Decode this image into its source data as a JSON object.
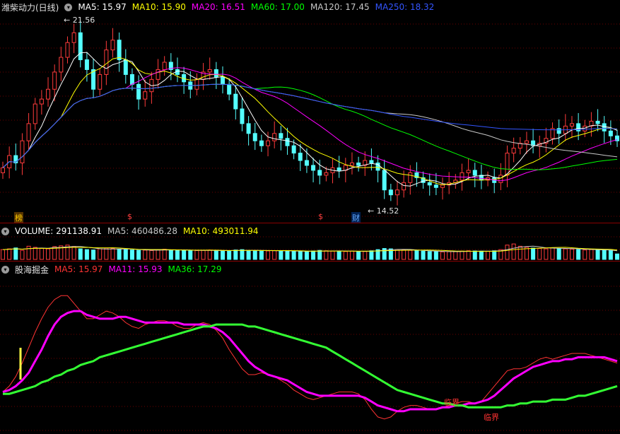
{
  "price_pane": {
    "stock_title": "潍柴动力(日线)",
    "ma_items": [
      {
        "label": "MA5: 15.97",
        "color": "#ffffff"
      },
      {
        "label": "MA10: 15.90",
        "color": "#ffff00"
      },
      {
        "label": "MA20: 16.51",
        "color": "#ff00ff"
      },
      {
        "label": "MA60: 17.00",
        "color": "#00ff00"
      },
      {
        "label": "MA120: 17.45",
        "color": "#c8c8c8"
      },
      {
        "label": "MA250: 18.32",
        "color": "#3355ff"
      }
    ],
    "high_label": "21.56",
    "low_label": "14.52",
    "event_tags": {
      "bang": "榜",
      "s1": "$",
      "s2": "$",
      "cai": "财"
    }
  },
  "volume_pane": {
    "items": [
      {
        "label": "VOLUME: 291138.91",
        "color": "#ffffff"
      },
      {
        "label": "MA5: 460486.28",
        "color": "#c8c8c8"
      },
      {
        "label": "MA10: 493011.94",
        "color": "#ffff00"
      }
    ]
  },
  "indicator_pane": {
    "title": "股海掘金",
    "items": [
      {
        "label": "MA5: 15.97",
        "color": "#ff3333"
      },
      {
        "label": "MA11: 15.93",
        "color": "#ff00ff"
      },
      {
        "label": "MA36: 17.29",
        "color": "#00ff00"
      }
    ],
    "critical_label_1": "临界",
    "critical_label_2": "临界"
  },
  "chart_data": {
    "type": "candlestick",
    "price_range": [
      14.0,
      22.0
    ],
    "closes": [
      15.8,
      16.3,
      16.0,
      16.9,
      17.6,
      18.4,
      18.6,
      19.0,
      19.7,
      20.3,
      20.9,
      21.3,
      20.2,
      19.8,
      19.0,
      19.6,
      20.6,
      21.0,
      20.2,
      19.6,
      19.2,
      18.6,
      18.9,
      19.4,
      19.8,
      20.1,
      19.8,
      19.6,
      19.3,
      19.0,
      19.4,
      19.7,
      19.8,
      19.5,
      19.2,
      18.8,
      18.2,
      17.6,
      17.2,
      16.9,
      16.7,
      16.9,
      17.2,
      17.0,
      16.7,
      16.4,
      16.1,
      15.9,
      15.7,
      15.5,
      15.6,
      15.8,
      15.7,
      15.9,
      16.0,
      15.9,
      16.1,
      16.0,
      15.7,
      14.9,
      14.7,
      14.9,
      15.2,
      15.6,
      15.4,
      15.2,
      15.1,
      15.0,
      15.1,
      15.2,
      15.3,
      15.6,
      15.7,
      15.5,
      15.3,
      15.4,
      15.2,
      15.5,
      16.4,
      16.6,
      16.8,
      16.9,
      16.7,
      16.8,
      17.0,
      17.4,
      17.2,
      17.5,
      17.6,
      17.3,
      17.5,
      17.7,
      17.6,
      17.3,
      17.1,
      16.9
    ],
    "volume_range": [
      0,
      1200000
    ],
    "volumes": [
      520000,
      560000,
      610000,
      480000,
      700000,
      640000,
      590000,
      560000,
      680000,
      720000,
      760000,
      690000,
      560000,
      520000,
      500000,
      560000,
      600000,
      580000,
      540000,
      520000,
      500000,
      480000,
      490000,
      470000,
      520000,
      540000,
      500000,
      490000,
      480000,
      460000,
      470000,
      480000,
      500000,
      460000,
      440000,
      460000,
      500000,
      520000,
      480000,
      460000,
      440000,
      450000,
      470000,
      460000,
      440000,
      430000,
      420000,
      410000,
      450000,
      480000,
      460000,
      440000,
      430000,
      420000,
      440000,
      430000,
      420000,
      460000,
      520000,
      580000,
      560000,
      520000,
      500000,
      480000,
      460000,
      440000,
      420000,
      410000,
      400000,
      410000,
      420000,
      440000,
      460000,
      450000,
      440000,
      430000,
      460000,
      520000,
      760000,
      820000,
      700000,
      640000,
      600000,
      580000,
      560000,
      620000,
      580000,
      560000,
      540000,
      520000,
      500000,
      520000,
      510000,
      490000,
      470000,
      291139
    ],
    "indicator_range": [
      14.0,
      22.0
    ],
    "ind_ma5": [
      16.0,
      16.3,
      16.8,
      17.5,
      18.3,
      19.1,
      19.8,
      20.4,
      20.8,
      21.0,
      21.0,
      20.6,
      20.2,
      19.8,
      19.8,
      20.0,
      20.2,
      20.1,
      19.9,
      19.6,
      19.4,
      19.3,
      19.5,
      19.6,
      19.7,
      19.7,
      19.6,
      19.4,
      19.3,
      19.3,
      19.5,
      19.6,
      19.5,
      19.2,
      18.8,
      18.2,
      17.7,
      17.2,
      16.9,
      16.9,
      17.0,
      16.9,
      16.8,
      16.6,
      16.4,
      16.1,
      15.9,
      15.7,
      15.6,
      15.7,
      15.8,
      15.9,
      16.0,
      16.0,
      16.0,
      15.9,
      15.6,
      15.1,
      14.7,
      14.6,
      14.7,
      15.0,
      15.2,
      15.3,
      15.3,
      15.2,
      15.1,
      15.1,
      15.2,
      15.3,
      15.4,
      15.5,
      15.5,
      15.4,
      15.5,
      15.9,
      16.3,
      16.7,
      17.1,
      17.2,
      17.2,
      17.3,
      17.5,
      17.7,
      17.8,
      17.7,
      17.8,
      17.9,
      18.0,
      18.0,
      18.0,
      17.9,
      17.8,
      17.7,
      17.6,
      17.5
    ],
    "ind_ma11": [
      16.0,
      16.1,
      16.3,
      16.6,
      17.0,
      17.6,
      18.2,
      18.9,
      19.5,
      19.9,
      20.1,
      20.2,
      20.2,
      20.0,
      19.9,
      19.8,
      19.8,
      19.8,
      19.9,
      19.9,
      19.8,
      19.7,
      19.6,
      19.6,
      19.6,
      19.6,
      19.6,
      19.6,
      19.5,
      19.5,
      19.5,
      19.5,
      19.4,
      19.3,
      19.1,
      18.8,
      18.4,
      18.0,
      17.6,
      17.3,
      17.1,
      16.9,
      16.8,
      16.7,
      16.6,
      16.4,
      16.2,
      16.0,
      15.9,
      15.8,
      15.8,
      15.8,
      15.8,
      15.8,
      15.8,
      15.8,
      15.7,
      15.5,
      15.3,
      15.2,
      15.1,
      15.0,
      15.0,
      15.1,
      15.1,
      15.1,
      15.1,
      15.1,
      15.2,
      15.2,
      15.3,
      15.3,
      15.4,
      15.4,
      15.5,
      15.6,
      15.8,
      16.1,
      16.4,
      16.7,
      16.9,
      17.1,
      17.3,
      17.4,
      17.5,
      17.6,
      17.6,
      17.7,
      17.7,
      17.8,
      17.8,
      17.8,
      17.8,
      17.8,
      17.7,
      17.6
    ],
    "ind_ma36": [
      15.9,
      15.9,
      16.0,
      16.1,
      16.2,
      16.3,
      16.5,
      16.6,
      16.8,
      16.9,
      17.1,
      17.2,
      17.4,
      17.5,
      17.6,
      17.8,
      17.9,
      18.0,
      18.1,
      18.2,
      18.3,
      18.4,
      18.5,
      18.6,
      18.7,
      18.8,
      18.9,
      19.0,
      19.1,
      19.2,
      19.3,
      19.4,
      19.4,
      19.5,
      19.5,
      19.5,
      19.5,
      19.5,
      19.4,
      19.4,
      19.3,
      19.2,
      19.1,
      19.0,
      18.9,
      18.8,
      18.7,
      18.6,
      18.5,
      18.4,
      18.3,
      18.1,
      17.9,
      17.7,
      17.5,
      17.3,
      17.1,
      16.9,
      16.7,
      16.5,
      16.3,
      16.1,
      16.0,
      15.9,
      15.8,
      15.7,
      15.6,
      15.5,
      15.4,
      15.4,
      15.3,
      15.3,
      15.2,
      15.2,
      15.2,
      15.2,
      15.2,
      15.2,
      15.3,
      15.3,
      15.4,
      15.4,
      15.5,
      15.5,
      15.5,
      15.6,
      15.6,
      15.6,
      15.7,
      15.8,
      15.8,
      15.9,
      16.0,
      16.1,
      16.2,
      16.3
    ]
  }
}
